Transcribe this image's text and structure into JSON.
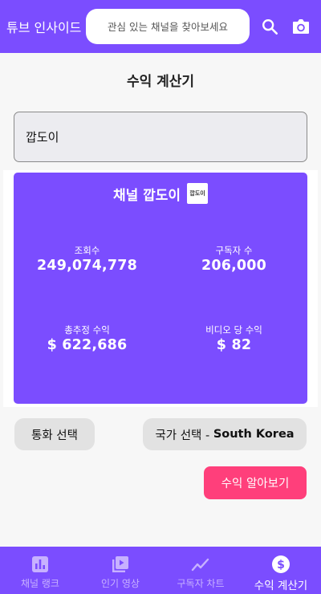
{
  "header": {
    "app_title": "튜브 인사이드",
    "search_placeholder": "관심 있는 채널을 찾아보세요",
    "search_icon": "search-icon",
    "camera_icon": "camera-icon"
  },
  "page": {
    "title": "수익 계산기"
  },
  "channel_input": {
    "value": "깝도이"
  },
  "result_card": {
    "title": "채널 깝도이",
    "thumbnail_text": "깝도이",
    "stats": {
      "views_label": "조회수",
      "views_value": "249,074,778",
      "subscribers_label": "구독자 수",
      "subscribers_value": "206,000",
      "total_revenue_label": "총추정 수익",
      "total_revenue_value": "$ 622,686",
      "per_video_label": "비디오 당 수익",
      "per_video_value": "$ 82"
    }
  },
  "options": {
    "currency_label": "통화 선택",
    "country_prefix": "국가 선택 - ",
    "country_value": "South Korea"
  },
  "calculate_button": "수익 알아보기",
  "bottom_nav": {
    "items": [
      {
        "label": "채널 랭크",
        "icon": "bar-chart-icon",
        "active": false
      },
      {
        "label": "인기 영상",
        "icon": "video-library-icon",
        "active": false
      },
      {
        "label": "구독자 차트",
        "icon": "trend-line-icon",
        "active": false
      },
      {
        "label": "수익 계산기",
        "icon": "dollar-icon",
        "active": true
      }
    ]
  },
  "colors": {
    "primary": "#7b4dff",
    "accent": "#ff3f7b",
    "inactive_nav": "#c7b1ff"
  }
}
